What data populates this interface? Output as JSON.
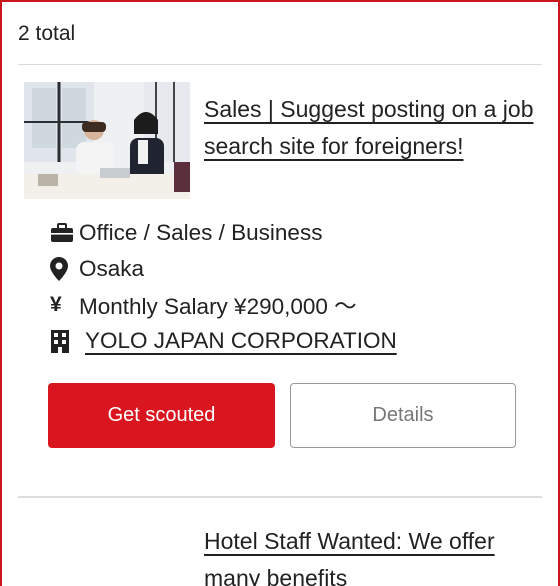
{
  "results": {
    "total_label": "2 total"
  },
  "jobs": [
    {
      "title": "Sales | Suggest posting on a job search site for foreigners!",
      "category": "Office / Sales / Business",
      "location": "Osaka",
      "salary": "Monthly Salary ¥290,000 ～",
      "salary_symbol": "¥",
      "company": "YOLO JAPAN CORPORATION",
      "primary_button": "Get scouted",
      "secondary_button": "Details",
      "image_alt": "office-photo"
    },
    {
      "title": "Hotel Staff Wanted: We offer many benefits"
    }
  ],
  "colors": {
    "accent": "#d9161f",
    "border": "#c9151e"
  },
  "icons": [
    "briefcase-icon",
    "map-pin-icon",
    "yen-icon",
    "building-icon"
  ]
}
